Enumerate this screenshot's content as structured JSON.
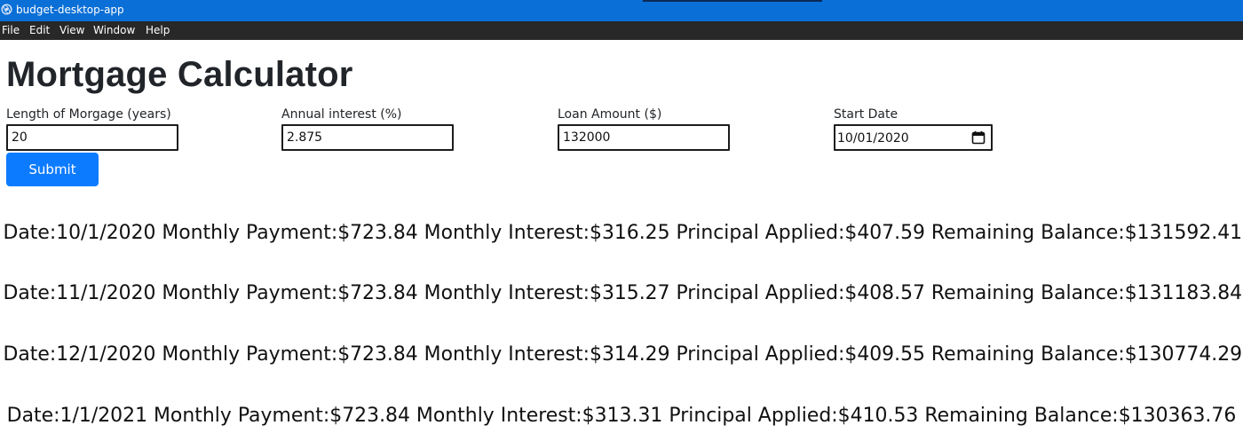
{
  "window": {
    "title": "budget-desktop-app"
  },
  "menu": [
    "File",
    "Edit",
    "View",
    "Window",
    "Help"
  ],
  "page": {
    "title": "Mortgage Calculator"
  },
  "form": {
    "length": {
      "label": "Length of Morgage (years)",
      "value": "20"
    },
    "interest": {
      "label": "Annual interest (%)",
      "value": "2.875"
    },
    "loan": {
      "label": "Loan Amount ($)",
      "value": "132000"
    },
    "start_date": {
      "label": "Start Date",
      "value": "10/01/2020"
    },
    "submit_label": "Submit"
  },
  "results": [
    "Date:10/1/2020 Monthly Payment:$723.84 Monthly Interest:$316.25 Principal Applied:$407.59 Remaining Balance:$131592.41",
    "Date:11/1/2020 Monthly Payment:$723.84 Monthly Interest:$315.27 Principal Applied:$408.57 Remaining Balance:$131183.84",
    "Date:12/1/2020 Monthly Payment:$723.84 Monthly Interest:$314.29 Principal Applied:$409.55 Remaining Balance:$130774.29",
    "Date:1/1/2021 Monthly Payment:$723.84 Monthly Interest:$313.31 Principal Applied:$410.53 Remaining Balance:$130363.76"
  ],
  "colors": {
    "titlebar": "#0a6fd6",
    "menubar": "#282828",
    "button": "#0d7bff"
  },
  "icons": [
    "app-icon",
    "calendar-icon"
  ]
}
